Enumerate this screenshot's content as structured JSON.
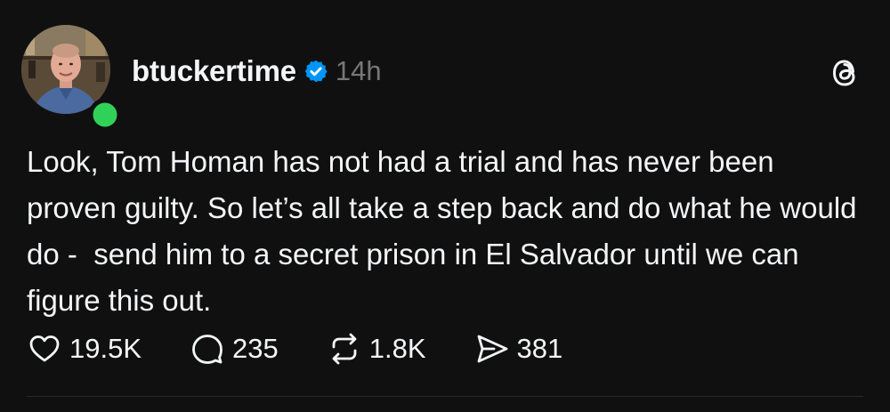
{
  "post": {
    "username": "btuckertime",
    "timestamp": "14h",
    "verified": true,
    "online": true,
    "text": "Look, Tom Homan has not had a trial and has never been proven guilty. So let’s all take a step back and do what he would do -  send him to a secret prison in El Salvador until we can figure this out.",
    "actions": {
      "likes": "19.5K",
      "replies": "235",
      "reposts": "1.8K",
      "shares": "381"
    }
  },
  "icons": {
    "like": "heart-icon",
    "reply": "speech-bubble-icon",
    "repost": "repost-arrows-icon",
    "share": "paper-plane-icon",
    "brand": "threads-logo-icon",
    "verified": "verified-badge-icon"
  },
  "colors": {
    "background": "#101010",
    "text": "#f3f5f7",
    "muted": "#777777",
    "verified": "#0095f6",
    "online": "#30d158"
  }
}
